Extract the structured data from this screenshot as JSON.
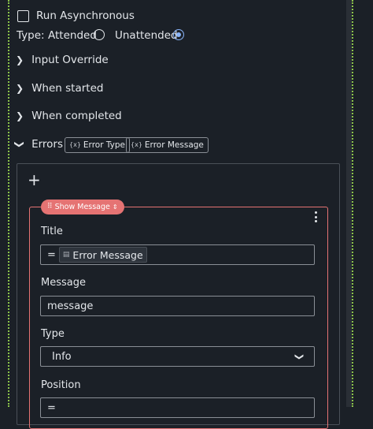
{
  "options": {
    "run_async_label": "Run Asynchronous",
    "type_label": "Type:",
    "attended_label": "Attended",
    "unattended_label": "Unattended",
    "selected_type": "Unattended"
  },
  "sections": {
    "input_override": "Input Override",
    "when_started": "When started",
    "when_completed": "When completed",
    "errors": "Errors"
  },
  "error_chips": {
    "error_type": "Error Type",
    "error_message": "Error Message"
  },
  "panel": {
    "add_symbol": "+"
  },
  "activity": {
    "badge_label": "Show Message",
    "title_label": "Title",
    "title_prefix": "=",
    "title_token": "Error Message",
    "message_label": "Message",
    "message_value": "message",
    "type_label": "Type",
    "type_value": "Info",
    "position_label": "Position",
    "position_value": "="
  },
  "icons": {
    "checkbox": "checkbox-icon",
    "chevron_right": "chevron-right-icon",
    "chevron_down": "chevron-down-icon",
    "variable": "variable-icon",
    "drag_handle": "drag-handle-icon",
    "kebab": "kebab-menu-icon",
    "token": "token-icon"
  },
  "colors": {
    "accent": "#8ab4f8",
    "activity_border": "#e57373",
    "dotted_edge": "#8bc34a"
  }
}
